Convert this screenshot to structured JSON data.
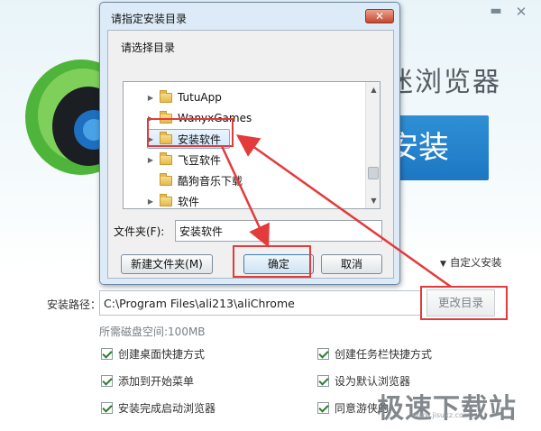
{
  "installer": {
    "brand_text": "迷浏览器",
    "install_label": "安装",
    "custom_install": "自定义安装",
    "path_label": "安装路径：",
    "path_value": "C:\\Program Files\\ali213\\aliChrome",
    "change_dir": "更改目录",
    "disk_space": "所需磁盘空间:100MB",
    "options": {
      "desktop_shortcut": "创建桌面快捷方式",
      "taskbar_shortcut": "创建任务栏快捷方式",
      "start_menu": "添加到开始菜单",
      "default_browser": "设为默认浏览器",
      "launch_after": "安装完成启动浏览器",
      "agree_terms": "同意游侠的"
    },
    "watermark": "极速下载站",
    "watermark_sub": "www.jisuxz.com"
  },
  "dialog": {
    "title": "请指定安装目录",
    "prompt": "请选择目录",
    "tree": [
      {
        "label": "TutuApp",
        "expandable": true
      },
      {
        "label": "WanyxGames",
        "expandable": true
      },
      {
        "label": "安装软件",
        "expandable": true,
        "selected": true
      },
      {
        "label": "飞豆软件",
        "expandable": true
      },
      {
        "label": "酷狗音乐下载",
        "expandable": false
      },
      {
        "label": "软件",
        "expandable": true
      }
    ],
    "folder_label": "文件夹(F):",
    "folder_value": "安装软件",
    "new_folder": "新建文件夹(M)",
    "ok": "确定",
    "cancel": "取消"
  },
  "icons": {
    "minimize": "minimize-icon",
    "close": "close-icon",
    "folder": "folder-icon",
    "expand": "chevron-right-icon"
  },
  "colors": {
    "accent_blue": "#1d77c4",
    "annotation_red": "#e33b3b"
  }
}
